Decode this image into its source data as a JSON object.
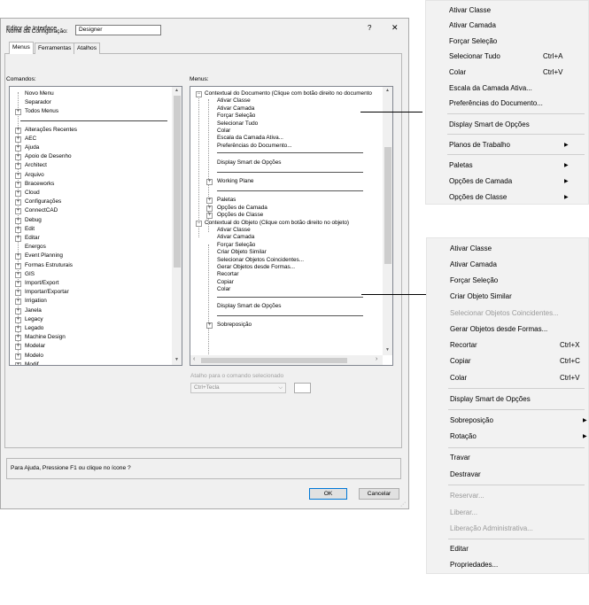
{
  "dialog": {
    "title": "Editor de Interface",
    "help": "?",
    "close": "✕",
    "config_label": "Nome da Configuração:",
    "config_value": "Designer",
    "tabs": [
      "Menus",
      "Ferramentas",
      "Atalhos"
    ],
    "commands_label": "Comandos:",
    "menus_label": "Menus:",
    "commands": [
      "Novo Menu",
      "Separador",
      "Todos Menus",
      "Alterações Recentes",
      "AEC",
      "Ajuda",
      "Apoio de Desenho",
      "Architect",
      "Arquivo",
      "Braceworks",
      "Cloud",
      "Configurações",
      "ConnectCAD",
      "Debug",
      "Edit",
      "Editar",
      "Energos",
      "Event Planning",
      "Formas Estruturais",
      "GIS",
      "Import/Export",
      "Importar/Exportar",
      "Irrigation",
      "Janela",
      "Legacy",
      "Legado",
      "Machine Design",
      "Modelar",
      "Modelo",
      "Modif"
    ],
    "menu_tree": [
      {
        "t": "Contextual do Documento (Clique com botão direito no documento",
        "lvl": 0
      },
      {
        "t": "Ativar Classe",
        "lvl": 1
      },
      {
        "t": "Ativar Camada",
        "lvl": 1
      },
      {
        "t": "Forçar Seleção",
        "lvl": 1
      },
      {
        "t": "Selecionar Tudo",
        "lvl": 1
      },
      {
        "t": "Colar",
        "lvl": 1
      },
      {
        "t": "Escala da Camada Ativa...",
        "lvl": 1
      },
      {
        "t": "Preferências do Documento...",
        "lvl": 1
      },
      {
        "t": "",
        "lvl": 1
      },
      {
        "t": "Display Smart de Opções",
        "lvl": 1
      },
      {
        "t": "",
        "lvl": 1
      },
      {
        "t": "Working Plane",
        "lvl": 1
      },
      {
        "t": "",
        "lvl": 1
      },
      {
        "t": "Paletas",
        "lvl": 1
      },
      {
        "t": "Opções de Camada",
        "lvl": 1
      },
      {
        "t": "Opções de Classe",
        "lvl": 1
      },
      {
        "t": "Contextual do Objeto (Clique com botão direito no objeto)",
        "lvl": 0
      },
      {
        "t": "Ativar Classe",
        "lvl": 1
      },
      {
        "t": "Ativar Camada",
        "lvl": 1
      },
      {
        "t": "Forçar Seleção",
        "lvl": 1
      },
      {
        "t": "Criar Objeto Similar",
        "lvl": 1
      },
      {
        "t": "Selecionar Objetos Coincidentes...",
        "lvl": 1
      },
      {
        "t": "Gerar Objetos desde Formas...",
        "lvl": 1
      },
      {
        "t": "Recortar",
        "lvl": 1
      },
      {
        "t": "Copiar",
        "lvl": 1
      },
      {
        "t": "Colar",
        "lvl": 1
      },
      {
        "t": "",
        "lvl": 1
      },
      {
        "t": "Display Smart de Opções",
        "lvl": 1
      },
      {
        "t": "",
        "lvl": 1
      },
      {
        "t": "Sobreposição",
        "lvl": 1
      }
    ],
    "shortcut_label": "Atalho para o comando selecionado",
    "shortcut_value": "Ctrl+Tecla",
    "help_text": "Para Ajuda, Pressione F1 ou clique no ícone ?",
    "ok": "OK",
    "cancel": "Cancelar"
  },
  "doc_menu": {
    "items": [
      {
        "label": "Ativar Classe"
      },
      {
        "label": "Ativar Camada"
      },
      {
        "label": "Forçar Seleção"
      },
      {
        "label": "Selecionar Tudo",
        "shortcut": "Ctrl+A"
      },
      {
        "label": "Colar",
        "shortcut": "Ctrl+V"
      },
      {
        "label": "Escala da Camada Ativa..."
      },
      {
        "label": "Preferências do Documento..."
      },
      {
        "label": "Display Smart de Opções"
      },
      {
        "label": "Planos de Trabalho",
        "sub": true
      },
      {
        "label": "Paletas",
        "sub": true
      },
      {
        "label": "Opções de Camada",
        "sub": true
      },
      {
        "label": "Opções de Classe",
        "sub": true
      }
    ]
  },
  "obj_menu": {
    "items": [
      {
        "label": "Ativar Classe"
      },
      {
        "label": "Ativar Camada"
      },
      {
        "label": "Forçar Seleção"
      },
      {
        "label": "Criar Objeto Similar"
      },
      {
        "label": "Selecionar Objetos Coincidentes...",
        "disabled": true
      },
      {
        "label": "Gerar Objetos desde Formas..."
      },
      {
        "label": "Recortar",
        "shortcut": "Ctrl+X"
      },
      {
        "label": "Copiar",
        "shortcut": "Ctrl+C"
      },
      {
        "label": "Colar",
        "shortcut": "Ctrl+V"
      },
      {
        "label": "Display Smart de Opções"
      },
      {
        "label": "Sobreposição",
        "sub": true
      },
      {
        "label": "Rotação",
        "sub": true
      },
      {
        "label": "Travar"
      },
      {
        "label": "Destravar"
      },
      {
        "label": "Reservar...",
        "disabled": true
      },
      {
        "label": "Liberar...",
        "disabled": true
      },
      {
        "label": "Liberação Administrativa...",
        "disabled": true
      },
      {
        "label": "Editar"
      },
      {
        "label": "Propriedades..."
      }
    ]
  },
  "icons": {
    "expand": "⊞",
    "submenu_arrow": "▶",
    "scroll_up": "▲",
    "scroll_down": "▼"
  }
}
